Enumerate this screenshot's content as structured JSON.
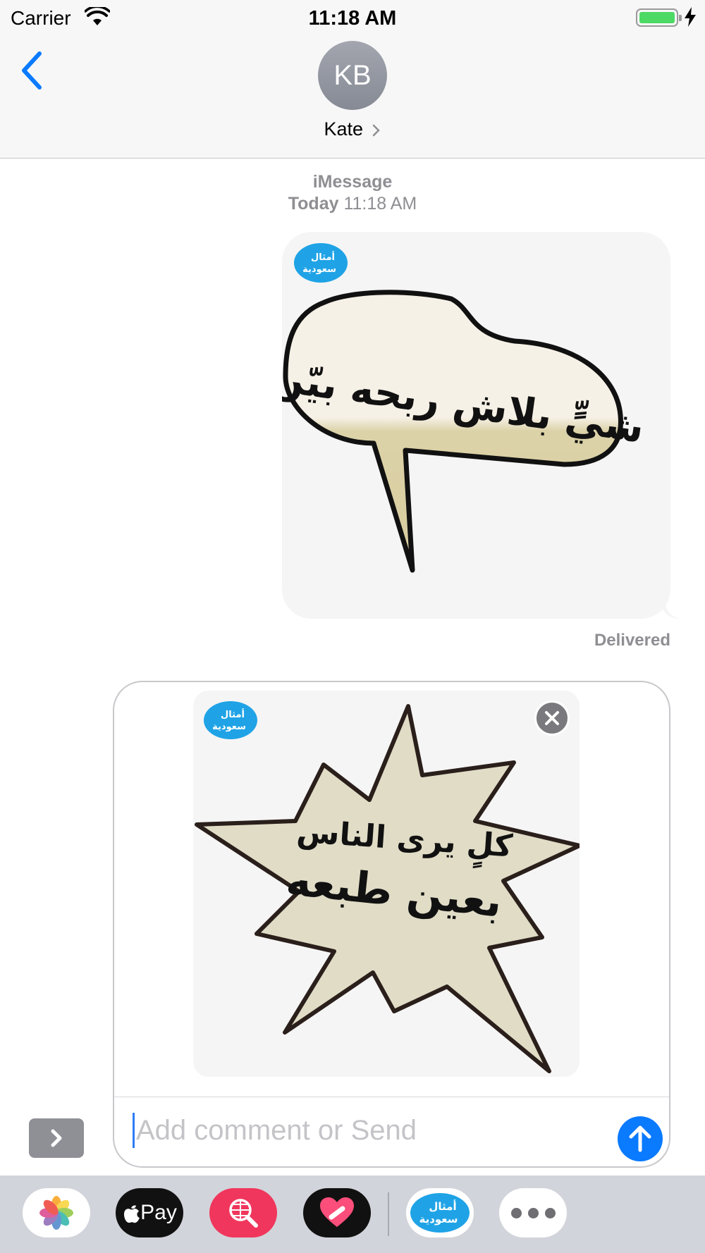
{
  "status_bar": {
    "carrier": "Carrier",
    "time": "11:18 AM",
    "battery_level": 1.0
  },
  "header": {
    "avatar_initials": "KB",
    "contact_name": "Kate"
  },
  "conversation": {
    "service": "iMessage",
    "day": "Today",
    "time": "11:18 AM",
    "sent_sticker": {
      "badge_line1": "أمثال",
      "badge_line2": "سعودية",
      "text": "شيٍّ بلاش ربحه بيّن"
    },
    "status": "Delivered"
  },
  "compose": {
    "attachment": {
      "badge_line1": "أمثال",
      "badge_line2": "سعودية",
      "text_line1": "كلٍ يرى الناس",
      "text_line2": "بعين طبعه"
    },
    "placeholder": "Add comment or Send"
  },
  "app_drawer": {
    "apps": [
      {
        "name": "photos-app",
        "label": ""
      },
      {
        "name": "apple-pay-app",
        "label": "Pay"
      },
      {
        "name": "web-search-app",
        "label": ""
      },
      {
        "name": "digital-touch-app",
        "label": ""
      },
      {
        "name": "sticker-app",
        "label": ""
      },
      {
        "name": "more-apps",
        "label": ""
      }
    ],
    "sticker_app_badge_line1": "أمثال",
    "sticker_app_badge_line2": "سعودية"
  },
  "colors": {
    "accent": "#0a7aff",
    "battery": "#4cd964",
    "badge_blue": "#1fa3e6",
    "bubble_cream": "#e2dcc2"
  }
}
